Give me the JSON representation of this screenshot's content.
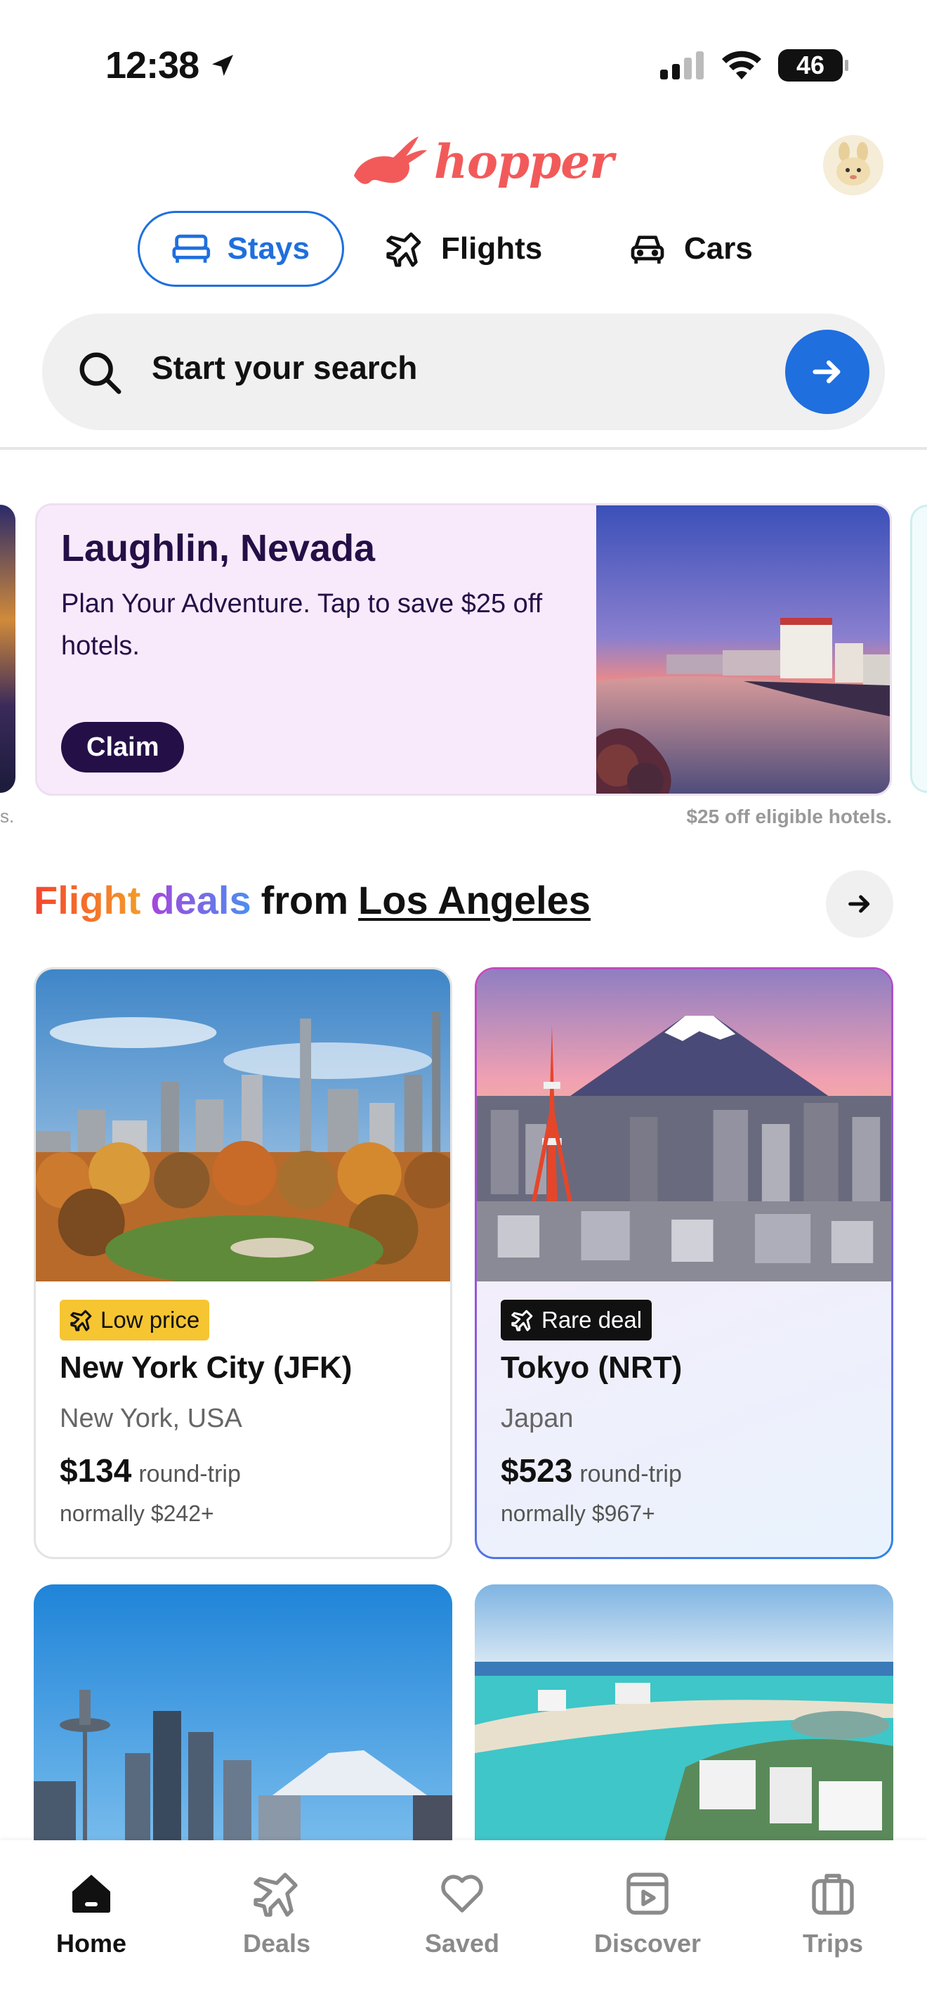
{
  "status_bar": {
    "time": "12:38",
    "battery": "46"
  },
  "header": {
    "logo_text": "hopper"
  },
  "tabs": [
    {
      "label": "Stays",
      "icon": "bed-icon",
      "active": true
    },
    {
      "label": "Flights",
      "icon": "plane-icon",
      "active": false
    },
    {
      "label": "Cars",
      "icon": "car-icon",
      "active": false
    }
  ],
  "search": {
    "placeholder": "Start your search"
  },
  "promo": {
    "title": "Laughlin, Nevada",
    "description": "Plan Your Adventure. Tap to save $25 off hotels.",
    "claim_label": "Claim",
    "footnote": "$25 off eligible hotels.",
    "prev_footnote_tail": "s."
  },
  "deals": {
    "heading_word1": "Flight",
    "heading_word2": "deals",
    "heading_word3": "from",
    "city": "Los Angeles"
  },
  "cards": [
    {
      "badge": "Low price",
      "title": "New York City (JFK)",
      "subtitle": "New York, USA",
      "price": "$134",
      "price_unit": "round-trip",
      "normal": "normally $242+"
    },
    {
      "badge": "Rare deal",
      "title": "Tokyo (NRT)",
      "subtitle": "Japan",
      "price": "$523",
      "price_unit": "round-trip",
      "normal": "normally $967+"
    }
  ],
  "bottom_nav": [
    {
      "label": "Home",
      "icon": "home-icon",
      "active": true
    },
    {
      "label": "Deals",
      "icon": "plane-icon",
      "active": false
    },
    {
      "label": "Saved",
      "icon": "heart-icon",
      "active": false
    },
    {
      "label": "Discover",
      "icon": "play-icon",
      "active": false
    },
    {
      "label": "Trips",
      "icon": "suitcase-icon",
      "active": false
    }
  ],
  "colors": {
    "accent_blue": "#1f6fde",
    "brand_coral": "#f25a5a",
    "promo_bg": "#f9eafb",
    "promo_dark": "#241047",
    "low_price_badge": "#f6c532"
  }
}
